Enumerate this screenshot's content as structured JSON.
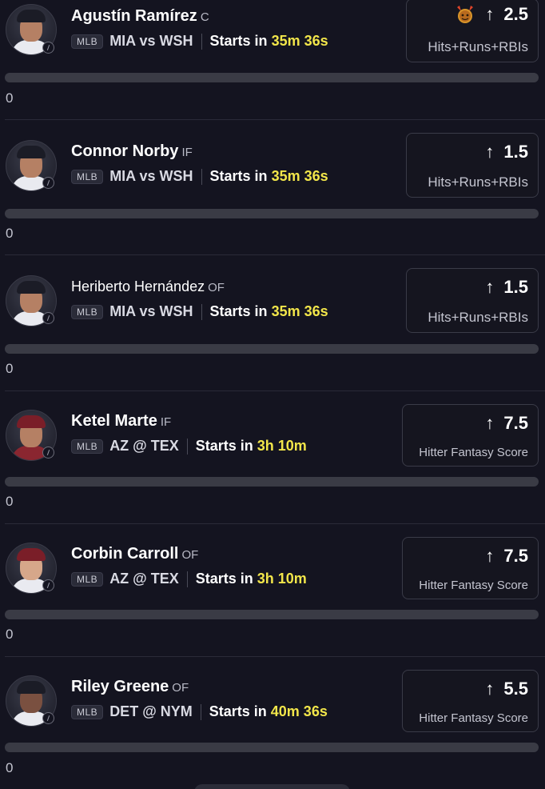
{
  "colors": {
    "background": "#141420",
    "accent_time": "#f2e64a",
    "progress_track": "#3a3b45",
    "card_border": "#3a3b48"
  },
  "picks": [
    {
      "player_name": "Agustín Ramírez",
      "position": "C",
      "league": "MLB",
      "matchup": "MIA vs WSH",
      "starts_label": "Starts in",
      "starts_time": "35m 36s",
      "direction_icon": "arrow-up-icon",
      "line_value": "2.5",
      "stat_label": "Hits+Runs+RBIs",
      "special_icon": "demon-icon",
      "progress_fraction": 0,
      "count": "0"
    },
    {
      "player_name": "Connor Norby",
      "position": "IF",
      "league": "MLB",
      "matchup": "MIA vs WSH",
      "starts_label": "Starts in",
      "starts_time": "35m 36s",
      "direction_icon": "arrow-up-icon",
      "line_value": "1.5",
      "stat_label": "Hits+Runs+RBIs",
      "progress_fraction": 0,
      "count": "0"
    },
    {
      "player_name": "Heriberto Hernández",
      "position": "OF",
      "league": "MLB",
      "matchup": "MIA vs WSH",
      "starts_label": "Starts in",
      "starts_time": "35m 36s",
      "direction_icon": "arrow-up-icon",
      "line_value": "1.5",
      "stat_label": "Hits+Runs+RBIs",
      "progress_fraction": 0,
      "count": "0"
    },
    {
      "player_name": "Ketel Marte",
      "position": "IF",
      "league": "MLB",
      "matchup": "AZ @ TEX",
      "starts_label": "Starts in",
      "starts_time": "3h 10m",
      "direction_icon": "arrow-up-icon",
      "line_value": "7.5",
      "stat_label": "Hitter Fantasy Score",
      "progress_fraction": 0,
      "count": "0"
    },
    {
      "player_name": "Corbin Carroll",
      "position": "OF",
      "league": "MLB",
      "matchup": "AZ @ TEX",
      "starts_label": "Starts in",
      "starts_time": "3h 10m",
      "direction_icon": "arrow-up-icon",
      "line_value": "7.5",
      "stat_label": "Hitter Fantasy Score",
      "progress_fraction": 0,
      "count": "0"
    },
    {
      "player_name": "Riley Greene",
      "position": "OF",
      "league": "MLB",
      "matchup": "DET @ NYM",
      "starts_label": "Starts in",
      "starts_time": "40m 36s",
      "direction_icon": "arrow-up-icon",
      "line_value": "5.5",
      "stat_label": "Hitter Fantasy Score",
      "progress_fraction": 0,
      "count": "0"
    }
  ]
}
